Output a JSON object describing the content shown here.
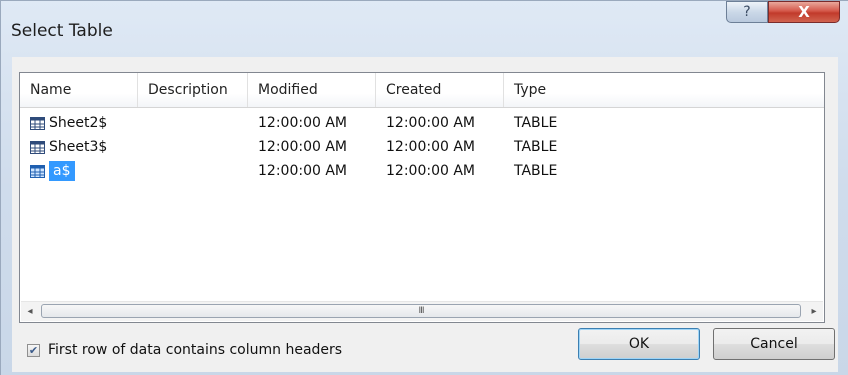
{
  "window": {
    "title": "Select Table",
    "help_glyph": "?",
    "close_glyph": "X"
  },
  "columns": [
    {
      "label": "Name"
    },
    {
      "label": "Description"
    },
    {
      "label": "Modified"
    },
    {
      "label": "Created"
    },
    {
      "label": "Type"
    }
  ],
  "rows": [
    {
      "name": "Sheet2$",
      "description": "",
      "modified": "12:00:00 AM",
      "created": "12:00:00 AM",
      "type": "TABLE",
      "icon": "table-icon",
      "selected": false
    },
    {
      "name": "Sheet3$",
      "description": "",
      "modified": "12:00:00 AM",
      "created": "12:00:00 AM",
      "type": "TABLE",
      "icon": "table-icon",
      "selected": false
    },
    {
      "name": "a$",
      "description": "",
      "modified": "12:00:00 AM",
      "created": "12:00:00 AM",
      "type": "TABLE",
      "icon": "table-icon",
      "selected": true
    }
  ],
  "scrollbar": {
    "left_glyph": "◂",
    "right_glyph": "▸",
    "grip_glyph": "III"
  },
  "options": {
    "first_row_header_label": "First row of data contains column headers",
    "first_row_header_checked": true,
    "check_glyph": "✔"
  },
  "buttons": {
    "ok_label": "OK",
    "cancel_label": "Cancel"
  },
  "colors": {
    "selection": "#3399ff",
    "close_button": "#c13a2b"
  }
}
